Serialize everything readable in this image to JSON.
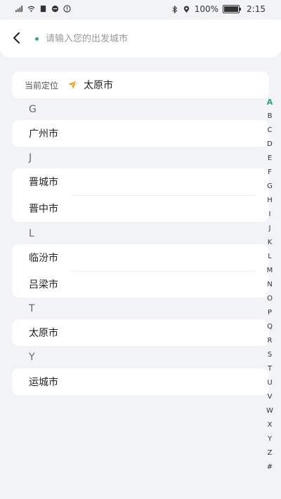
{
  "status_bar": {
    "battery_text": "100%",
    "time": "2:15"
  },
  "header": {
    "search_placeholder": "请输入您的出发城市"
  },
  "current_location": {
    "label": "当前定位",
    "city": "太原市"
  },
  "sections": [
    {
      "letter": "G",
      "cities": [
        "广州市"
      ]
    },
    {
      "letter": "J",
      "cities": [
        "晋城市",
        "晋中市"
      ]
    },
    {
      "letter": "L",
      "cities": [
        "临汾市",
        "吕梁市"
      ]
    },
    {
      "letter": "T",
      "cities": [
        "太原市"
      ]
    },
    {
      "letter": "Y",
      "cities": [
        "运城市"
      ]
    }
  ],
  "index_letters": [
    "A",
    "B",
    "C",
    "D",
    "E",
    "F",
    "G",
    "H",
    "I",
    "J",
    "K",
    "L",
    "M",
    "N",
    "O",
    "P",
    "Q",
    "R",
    "S",
    "T",
    "U",
    "V",
    "W",
    "X",
    "Y",
    "Z",
    "#"
  ],
  "index_active": "A",
  "colors": {
    "accent": "#2f9f6e",
    "location_icon": "#e0a22a",
    "background": "#f2f3f7"
  }
}
